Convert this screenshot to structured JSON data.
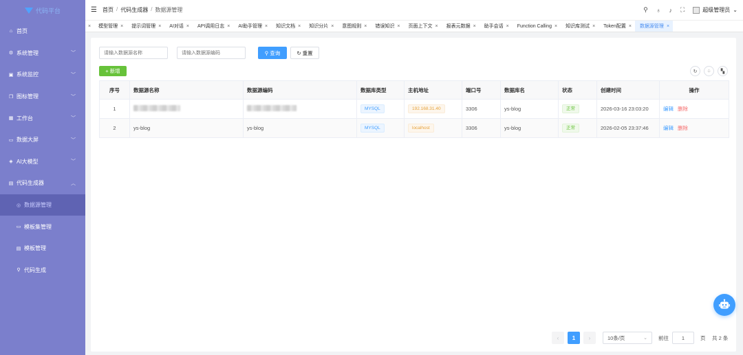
{
  "logo": {
    "text": "代码平台"
  },
  "sidebar": {
    "items": [
      {
        "label": "首页",
        "icon": "⌂",
        "has_chevron": false
      },
      {
        "label": "系统管理",
        "icon": "⚙",
        "has_chevron": true
      },
      {
        "label": "系统监控",
        "icon": "▣",
        "has_chevron": true
      },
      {
        "label": "图标管理",
        "icon": "❐",
        "has_chevron": true
      },
      {
        "label": "工作台",
        "icon": "▦",
        "has_chevron": true
      },
      {
        "label": "数据大屏",
        "icon": "▭",
        "has_chevron": true
      },
      {
        "label": "AI大模型",
        "icon": "◈",
        "has_chevron": true
      },
      {
        "label": "代码生成器",
        "icon": "▤",
        "has_chevron": true,
        "expanded": true
      }
    ],
    "subitems": [
      {
        "label": "数据源管理",
        "icon": "◎",
        "active": true
      },
      {
        "label": "模板集管理",
        "icon": "▭",
        "active": false
      },
      {
        "label": "模板管理",
        "icon": "▤",
        "active": false
      },
      {
        "label": "代码生成",
        "icon": "⚲",
        "active": false
      }
    ]
  },
  "topbar": {
    "breadcrumb": [
      "首页",
      "代码生成器",
      "数据源管理"
    ],
    "user_name": "超级管理员"
  },
  "tags": [
    "模型管理",
    "提示词管理",
    "AI对话",
    "API调用日志",
    "AI助手管理",
    "知识文档",
    "知识分片",
    "意图规则",
    "错误知识",
    "页面上下文",
    "报表元数据",
    "助手会话",
    "Function Calling",
    "知识库测试",
    "Token配置",
    "数据源管理"
  ],
  "active_tag": "数据源管理",
  "search": {
    "name_placeholder": "请输入数据源名称",
    "code_placeholder": "请输入数据源编码",
    "query_label": "查询",
    "reset_label": "重置",
    "add_label": "新增"
  },
  "table": {
    "columns": [
      "序号",
      "数据源名称",
      "数据源编码",
      "数据库类型",
      "主机地址",
      "端口号",
      "数据库名",
      "状态",
      "创建时间",
      "操作"
    ],
    "rows": [
      {
        "index": "1",
        "name": "",
        "code": "",
        "name_redacted": true,
        "db_type": "MYSQL",
        "host": "192.168.31.40",
        "port": "3306",
        "db_name": "ys-blog",
        "status": "正常",
        "created": "2026-03-16 23:03:20",
        "edit": "编辑",
        "delete": "删除"
      },
      {
        "index": "2",
        "name": "ys-blog",
        "code": "ys-blog",
        "name_redacted": false,
        "db_type": "MYSQL",
        "host": "localhost",
        "port": "3306",
        "db_name": "ys-blog",
        "status": "正常",
        "created": "2026-02-05 23:37:46",
        "edit": "编辑",
        "delete": "删除"
      }
    ]
  },
  "pagination": {
    "current_page": "1",
    "page_size_label": "10条/页",
    "goto_label": "前往",
    "goto_value": "1",
    "page_unit": "页",
    "total_label": "共 2 条"
  },
  "colors": {
    "sidebar_bg": "#7b7fcc",
    "primary": "#409eff",
    "success": "#67c23a",
    "danger": "#f56c6c",
    "warning": "#e6a23c"
  }
}
